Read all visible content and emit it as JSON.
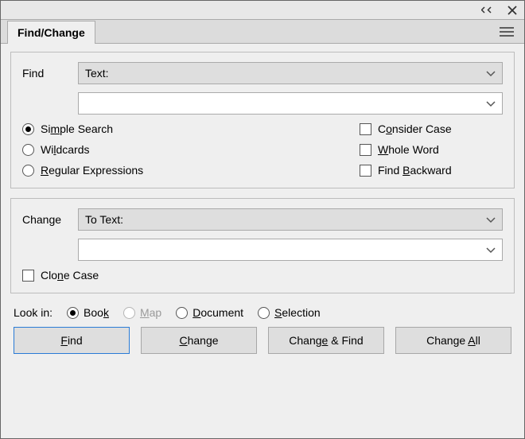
{
  "chrome": {
    "collapse_tooltip": "Collapse",
    "close_tooltip": "Close"
  },
  "tab": {
    "title": "Find/Change"
  },
  "find": {
    "label": "Find",
    "mode_label": "Text:",
    "value": "",
    "search_modes": {
      "simple": {
        "label_pre": "Si",
        "label_u": "m",
        "label_post": "ple Search",
        "checked": true
      },
      "wildcards": {
        "label_pre": "Wi",
        "label_u": "l",
        "label_post": "dcards",
        "checked": false
      },
      "regex": {
        "label_pre": "",
        "label_u": "R",
        "label_post": "egular Expressions",
        "checked": false
      }
    },
    "options": {
      "consider_case": {
        "label_pre": "C",
        "label_u": "o",
        "label_post": "nsider Case",
        "checked": false
      },
      "whole_word": {
        "label_pre": "",
        "label_u": "W",
        "label_post": "hole Word",
        "checked": false
      },
      "find_backward": {
        "label_pre": "Find ",
        "label_u": "B",
        "label_post": "ackward",
        "checked": false
      }
    }
  },
  "change": {
    "label": "Change",
    "mode_label": "To Text:",
    "value": "",
    "clone_case": {
      "label_pre": "Clo",
      "label_u": "n",
      "label_post": "e Case",
      "checked": false
    }
  },
  "lookin": {
    "label": "Look in:",
    "book": {
      "label_pre": "Boo",
      "label_u": "k",
      "label_post": "",
      "checked": true,
      "disabled": false
    },
    "map": {
      "label_pre": "",
      "label_u": "M",
      "label_post": "ap",
      "checked": false,
      "disabled": true
    },
    "document": {
      "label_pre": "",
      "label_u": "D",
      "label_post": "ocument",
      "checked": false,
      "disabled": false
    },
    "selection": {
      "label_pre": "",
      "label_u": "S",
      "label_post": "election",
      "checked": false,
      "disabled": false
    }
  },
  "buttons": {
    "find": {
      "pre": "",
      "u": "F",
      "post": "ind"
    },
    "change": {
      "pre": "",
      "u": "C",
      "post": "hange"
    },
    "change_find": {
      "pre": "Chang",
      "u": "e",
      "post": " & Find"
    },
    "change_all": {
      "pre": "Change ",
      "u": "A",
      "post": "ll"
    }
  }
}
